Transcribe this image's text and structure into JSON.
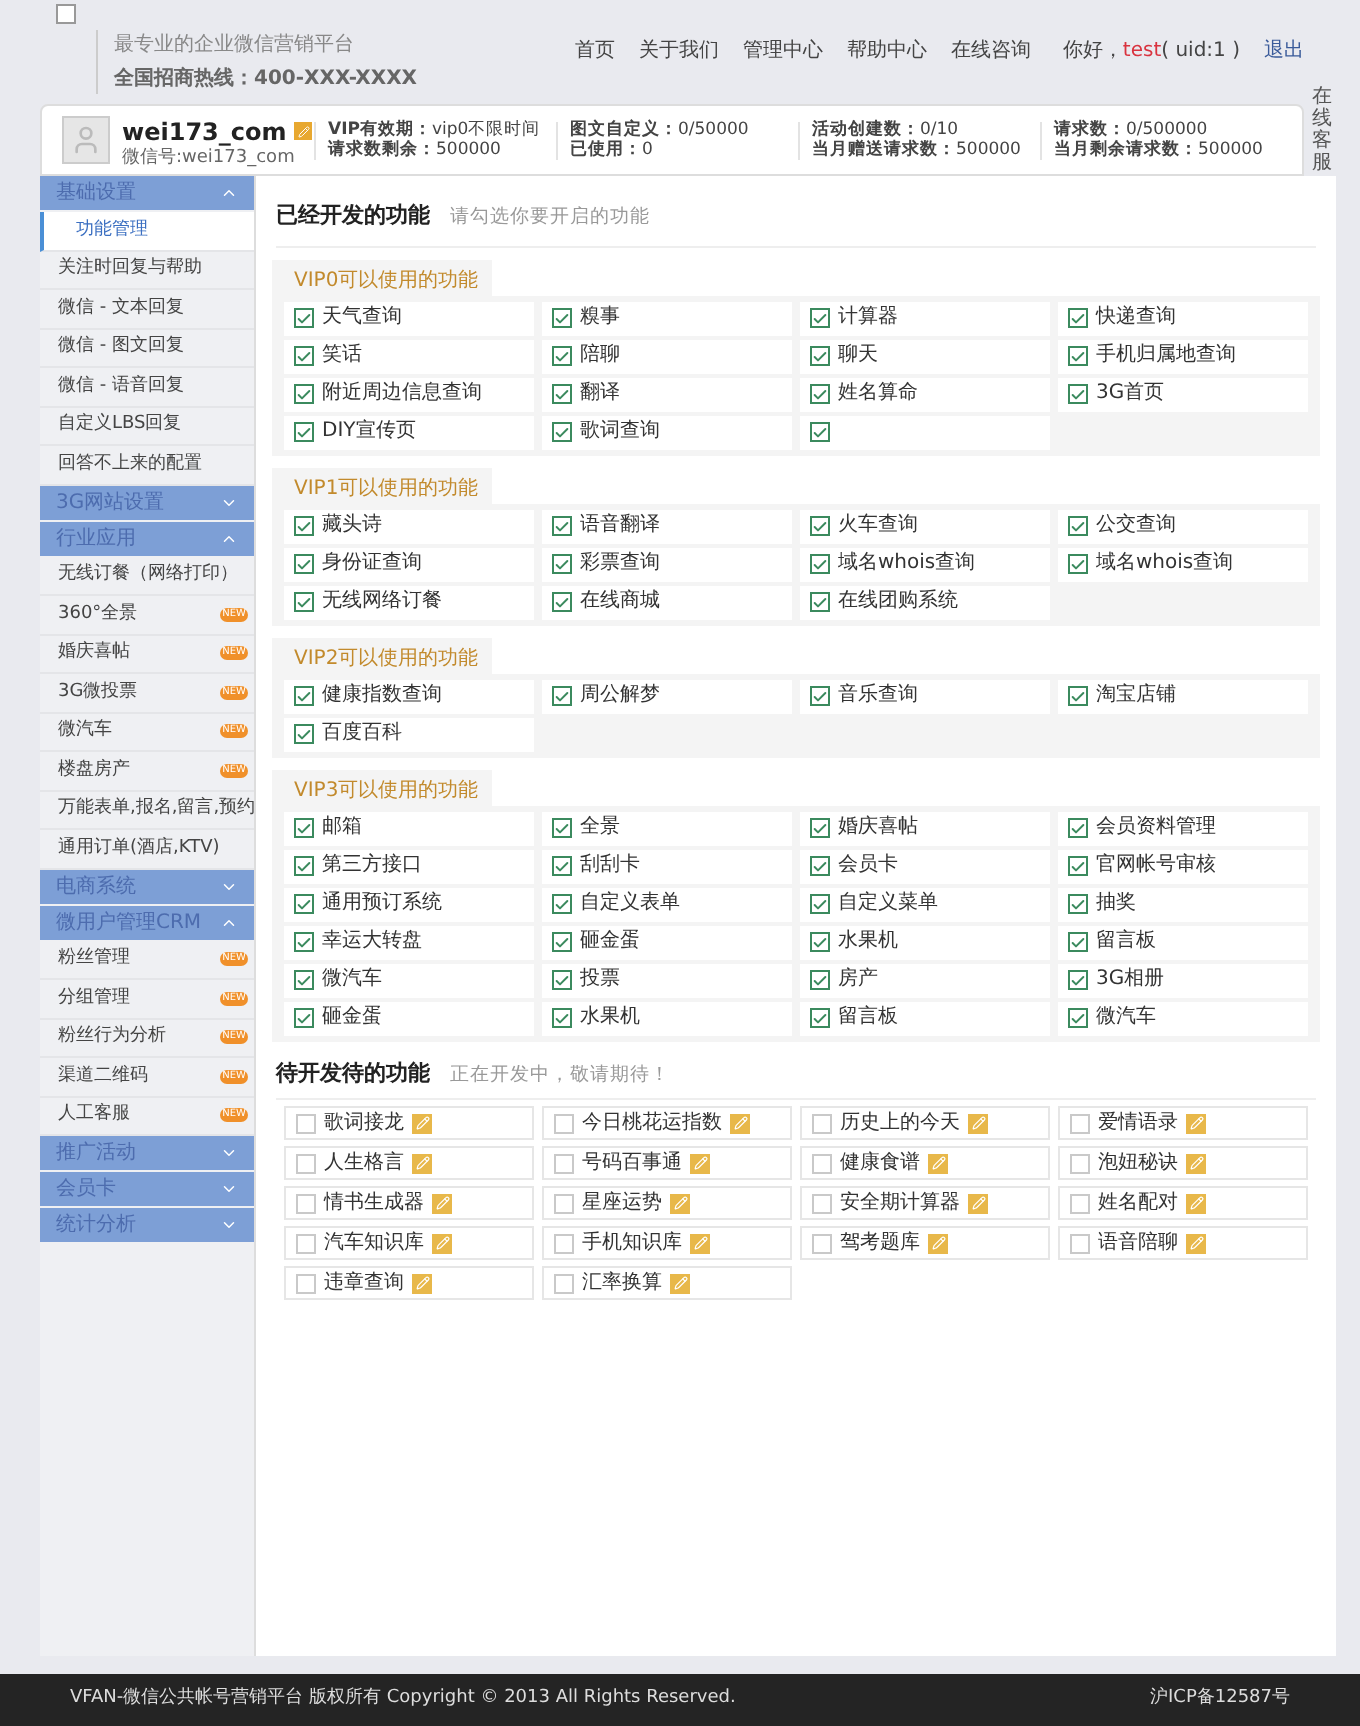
{
  "header": {
    "tagline": "最专业的企业微信营销平台",
    "hotline": "全国招商热线：400-XXX-XXXX",
    "nav": [
      "首页",
      "关于我们",
      "管理中心",
      "帮助中心",
      "在线咨询"
    ],
    "greeting": "你好，",
    "user": "test",
    "uid": "( uid:1 )",
    "logout": "退出"
  },
  "side_service": "在线客服",
  "profile": {
    "username": "wei173_com",
    "wechat": "微信号:wei173_com",
    "stats": [
      [
        {
          "label": "VIP有效期：",
          "value": "vip0不限时间"
        },
        {
          "label": "请求数剩余：",
          "value": "500000"
        }
      ],
      [
        {
          "label": "图文自定义：",
          "value": "0/50000"
        },
        {
          "label": "已使用：",
          "value": "0"
        }
      ],
      [
        {
          "label": "活动创建数：",
          "value": "0/10"
        },
        {
          "label": "当月赠送请求数：",
          "value": "500000"
        }
      ],
      [
        {
          "label": "请求数：",
          "value": "0/500000"
        },
        {
          "label": "当月剩余请求数：",
          "value": "500000"
        }
      ]
    ]
  },
  "sidebar": [
    {
      "title": "基础设置",
      "expanded": true,
      "items": [
        {
          "label": "功能管理",
          "selected": true
        },
        {
          "label": "关注时回复与帮助",
          "selected": false
        },
        {
          "label": "微信 - 文本回复",
          "selected": false
        },
        {
          "label": "微信 - 图文回复",
          "selected": false
        },
        {
          "label": "微信 - 语音回复",
          "selected": false
        },
        {
          "label": "自定义LBS回复",
          "selected": false
        },
        {
          "label": "回答不上来的配置",
          "selected": false
        }
      ]
    },
    {
      "title": "3G网站设置",
      "expanded": false
    },
    {
      "title": "行业应用",
      "expanded": true,
      "items": [
        {
          "label": "无线订餐（网络打印）",
          "selected": false
        },
        {
          "label": "360°全景",
          "selected": false,
          "badge": "NEW"
        },
        {
          "label": "婚庆喜帖",
          "selected": false,
          "badge": "NEW"
        },
        {
          "label": "3G微投票",
          "selected": false,
          "badge": "NEW"
        },
        {
          "label": "微汽车",
          "selected": false,
          "badge": "NEW"
        },
        {
          "label": "楼盘房产",
          "selected": false,
          "badge": "NEW"
        },
        {
          "label": "万能表单,报名,留言,预约",
          "selected": false
        },
        {
          "label": "通用订单(酒店,KTV)",
          "selected": false
        }
      ]
    },
    {
      "title": "电商系统",
      "expanded": false
    },
    {
      "title": "微用户管理CRM",
      "expanded": true,
      "items": [
        {
          "label": "粉丝管理",
          "selected": false,
          "badge": "NEW"
        },
        {
          "label": "分组管理",
          "selected": false,
          "badge": "NEW"
        },
        {
          "label": "粉丝行为分析",
          "selected": false,
          "badge": "NEW"
        },
        {
          "label": "渠道二维码",
          "selected": false,
          "badge": "NEW"
        },
        {
          "label": "人工客服",
          "selected": false,
          "badge": "NEW"
        }
      ]
    },
    {
      "title": "推广活动",
      "expanded": false
    },
    {
      "title": "会员卡",
      "expanded": false
    },
    {
      "title": "统计分析",
      "expanded": false
    }
  ],
  "developed": {
    "title": "已经开发的功能",
    "hint": "请勾选你要开启的功能",
    "groups": [
      {
        "title": "VIP0可以使用的功能",
        "items": [
          {
            "label": "天气查询",
            "checked": true
          },
          {
            "label": "糗事",
            "checked": true
          },
          {
            "label": "计算器",
            "checked": true
          },
          {
            "label": "快递查询",
            "checked": true
          },
          {
            "label": "笑话",
            "checked": true
          },
          {
            "label": "陪聊",
            "checked": true
          },
          {
            "label": "聊天",
            "checked": true
          },
          {
            "label": "手机归属地查询",
            "checked": true
          },
          {
            "label": "附近周边信息查询",
            "checked": true
          },
          {
            "label": "翻译",
            "checked": true
          },
          {
            "label": "姓名算命",
            "checked": true
          },
          {
            "label": "3G首页",
            "checked": true
          },
          {
            "label": "DIY宣传页",
            "checked": true
          },
          {
            "label": "歌词查询",
            "checked": true
          },
          {
            "checked": true
          }
        ]
      },
      {
        "title": "VIP1可以使用的功能",
        "items": [
          {
            "label": "藏头诗",
            "checked": true
          },
          {
            "label": "语音翻译",
            "checked": true
          },
          {
            "label": "火车查询",
            "checked": true
          },
          {
            "label": "公交查询",
            "checked": true
          },
          {
            "label": "身份证查询",
            "checked": true
          },
          {
            "label": "彩票查询",
            "checked": true
          },
          {
            "label": "域名whois查询",
            "checked": true
          },
          {
            "label": "域名whois查询",
            "checked": true
          },
          {
            "label": "无线网络订餐",
            "checked": true
          },
          {
            "label": "在线商城",
            "checked": true
          },
          {
            "label": "在线团购系统",
            "checked": true
          }
        ]
      },
      {
        "title": "VIP2可以使用的功能",
        "items": [
          {
            "label": "健康指数查询",
            "checked": true
          },
          {
            "label": "周公解梦",
            "checked": true
          },
          {
            "label": "音乐查询",
            "checked": true
          },
          {
            "label": "淘宝店铺",
            "checked": true
          },
          {
            "label": "百度百科",
            "checked": true
          }
        ]
      },
      {
        "title": "VIP3可以使用的功能",
        "items": [
          {
            "label": "邮箱",
            "checked": true
          },
          {
            "label": "全景",
            "checked": true
          },
          {
            "label": "婚庆喜帖",
            "checked": true
          },
          {
            "label": "会员资料管理",
            "checked": true
          },
          {
            "label": "第三方接口",
            "checked": true
          },
          {
            "label": "刮刮卡",
            "checked": true
          },
          {
            "label": "会员卡",
            "checked": true
          },
          {
            "label": "官网帐号审核",
            "checked": true
          },
          {
            "label": "通用预订系统",
            "checked": true
          },
          {
            "label": "自定义表单",
            "checked": true
          },
          {
            "label": "自定义菜单",
            "checked": true
          },
          {
            "label": "抽奖",
            "checked": true
          },
          {
            "label": "幸运大转盘",
            "checked": true
          },
          {
            "label": "砸金蛋",
            "checked": true
          },
          {
            "label": "水果机",
            "checked": true
          },
          {
            "label": "留言板",
            "checked": true
          },
          {
            "label": "微汽车",
            "checked": true
          },
          {
            "label": "投票",
            "checked": true
          },
          {
            "label": "房产",
            "checked": true
          },
          {
            "label": "3G相册",
            "checked": true
          },
          {
            "label": "砸金蛋",
            "checked": true
          },
          {
            "label": "水果机",
            "checked": true
          },
          {
            "label": "留言板",
            "checked": true
          },
          {
            "label": "微汽车",
            "checked": true
          }
        ]
      }
    ]
  },
  "pending": {
    "title": "待开发待的功能",
    "hint": "正在开发中，敬请期待！",
    "items": [
      {
        "label": "歌词接龙",
        "checked": false
      },
      {
        "label": "今日桃花运指数",
        "checked": false
      },
      {
        "label": "历史上的今天",
        "checked": false
      },
      {
        "label": "爱情语录",
        "checked": false
      },
      {
        "label": "人生格言",
        "checked": false
      },
      {
        "label": "号码百事通",
        "checked": false
      },
      {
        "label": "健康食谱",
        "checked": false
      },
      {
        "label": "泡妞秘诀",
        "checked": false
      },
      {
        "label": "情书生成器",
        "checked": false
      },
      {
        "label": "星座运势",
        "checked": false
      },
      {
        "label": "安全期计算器",
        "checked": false
      },
      {
        "label": "姓名配对",
        "checked": false
      },
      {
        "label": "汽车知识库",
        "checked": false
      },
      {
        "label": "手机知识库",
        "checked": false
      },
      {
        "label": "驾考题库",
        "checked": false
      },
      {
        "label": "语音陪聊",
        "checked": false
      },
      {
        "label": "违章查询",
        "checked": false
      },
      {
        "label": "汇率换算",
        "checked": false
      }
    ]
  },
  "footer": {
    "copyright": "VFAN-微信公共帐号营销平台 版权所有 Copyright © 2013 All Rights Reserved.",
    "icp": "沪ICP备12587号"
  }
}
